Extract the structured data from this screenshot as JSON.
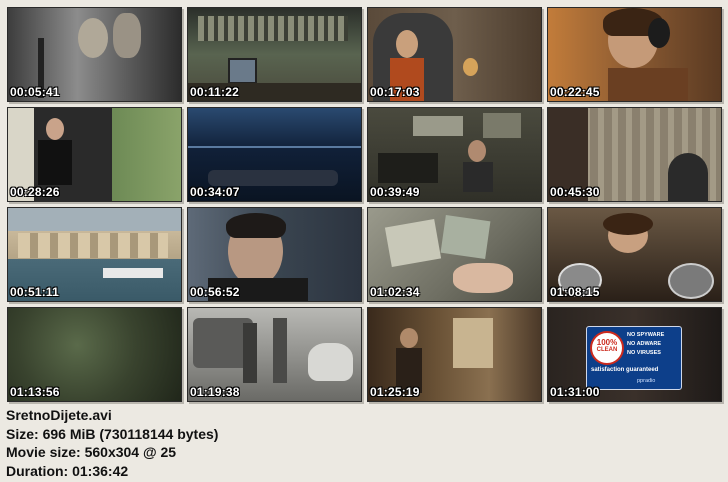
{
  "thumbnails": [
    {
      "time": "00:05:41",
      "bg": "#6c6c6c"
    },
    {
      "time": "00:11:22",
      "bg": "#4f5a4a"
    },
    {
      "time": "00:17:03",
      "bg": "#5b4a3c"
    },
    {
      "time": "00:22:45",
      "bg": "#7a4c2c"
    },
    {
      "time": "00:28:26",
      "bg": "#7f8a72"
    },
    {
      "time": "00:34:07",
      "bg": "#18253a"
    },
    {
      "time": "00:39:49",
      "bg": "#3f3f36"
    },
    {
      "time": "00:45:30",
      "bg": "#6b6456"
    },
    {
      "time": "00:51:11",
      "bg": "#7d8c95"
    },
    {
      "time": "00:56:52",
      "bg": "#3a4550"
    },
    {
      "time": "01:02:34",
      "bg": "#8a8a7e"
    },
    {
      "time": "01:08:15",
      "bg": "#3b3329"
    },
    {
      "time": "01:13:56",
      "bg": "#39432e"
    },
    {
      "time": "01:19:38",
      "bg": "#8e8e8a"
    },
    {
      "time": "01:25:19",
      "bg": "#4d3c2a"
    },
    {
      "time": "01:31:00",
      "bg": "#2b2522"
    }
  ],
  "info": {
    "filename": "SretnoDijete.avi",
    "size": "Size: 696 MiB (730118144 bytes)",
    "movie_size": "Movie size: 560x304 @ 25",
    "duration": "Duration: 01:36:42"
  },
  "badge": {
    "line1": "100%",
    "line2": "CLEAN",
    "items": [
      "NO SPYWARE",
      "NO ADWARE",
      "NO VIRUSES"
    ],
    "footer": "satisfaction guaranteed",
    "brand": "ppradio"
  }
}
